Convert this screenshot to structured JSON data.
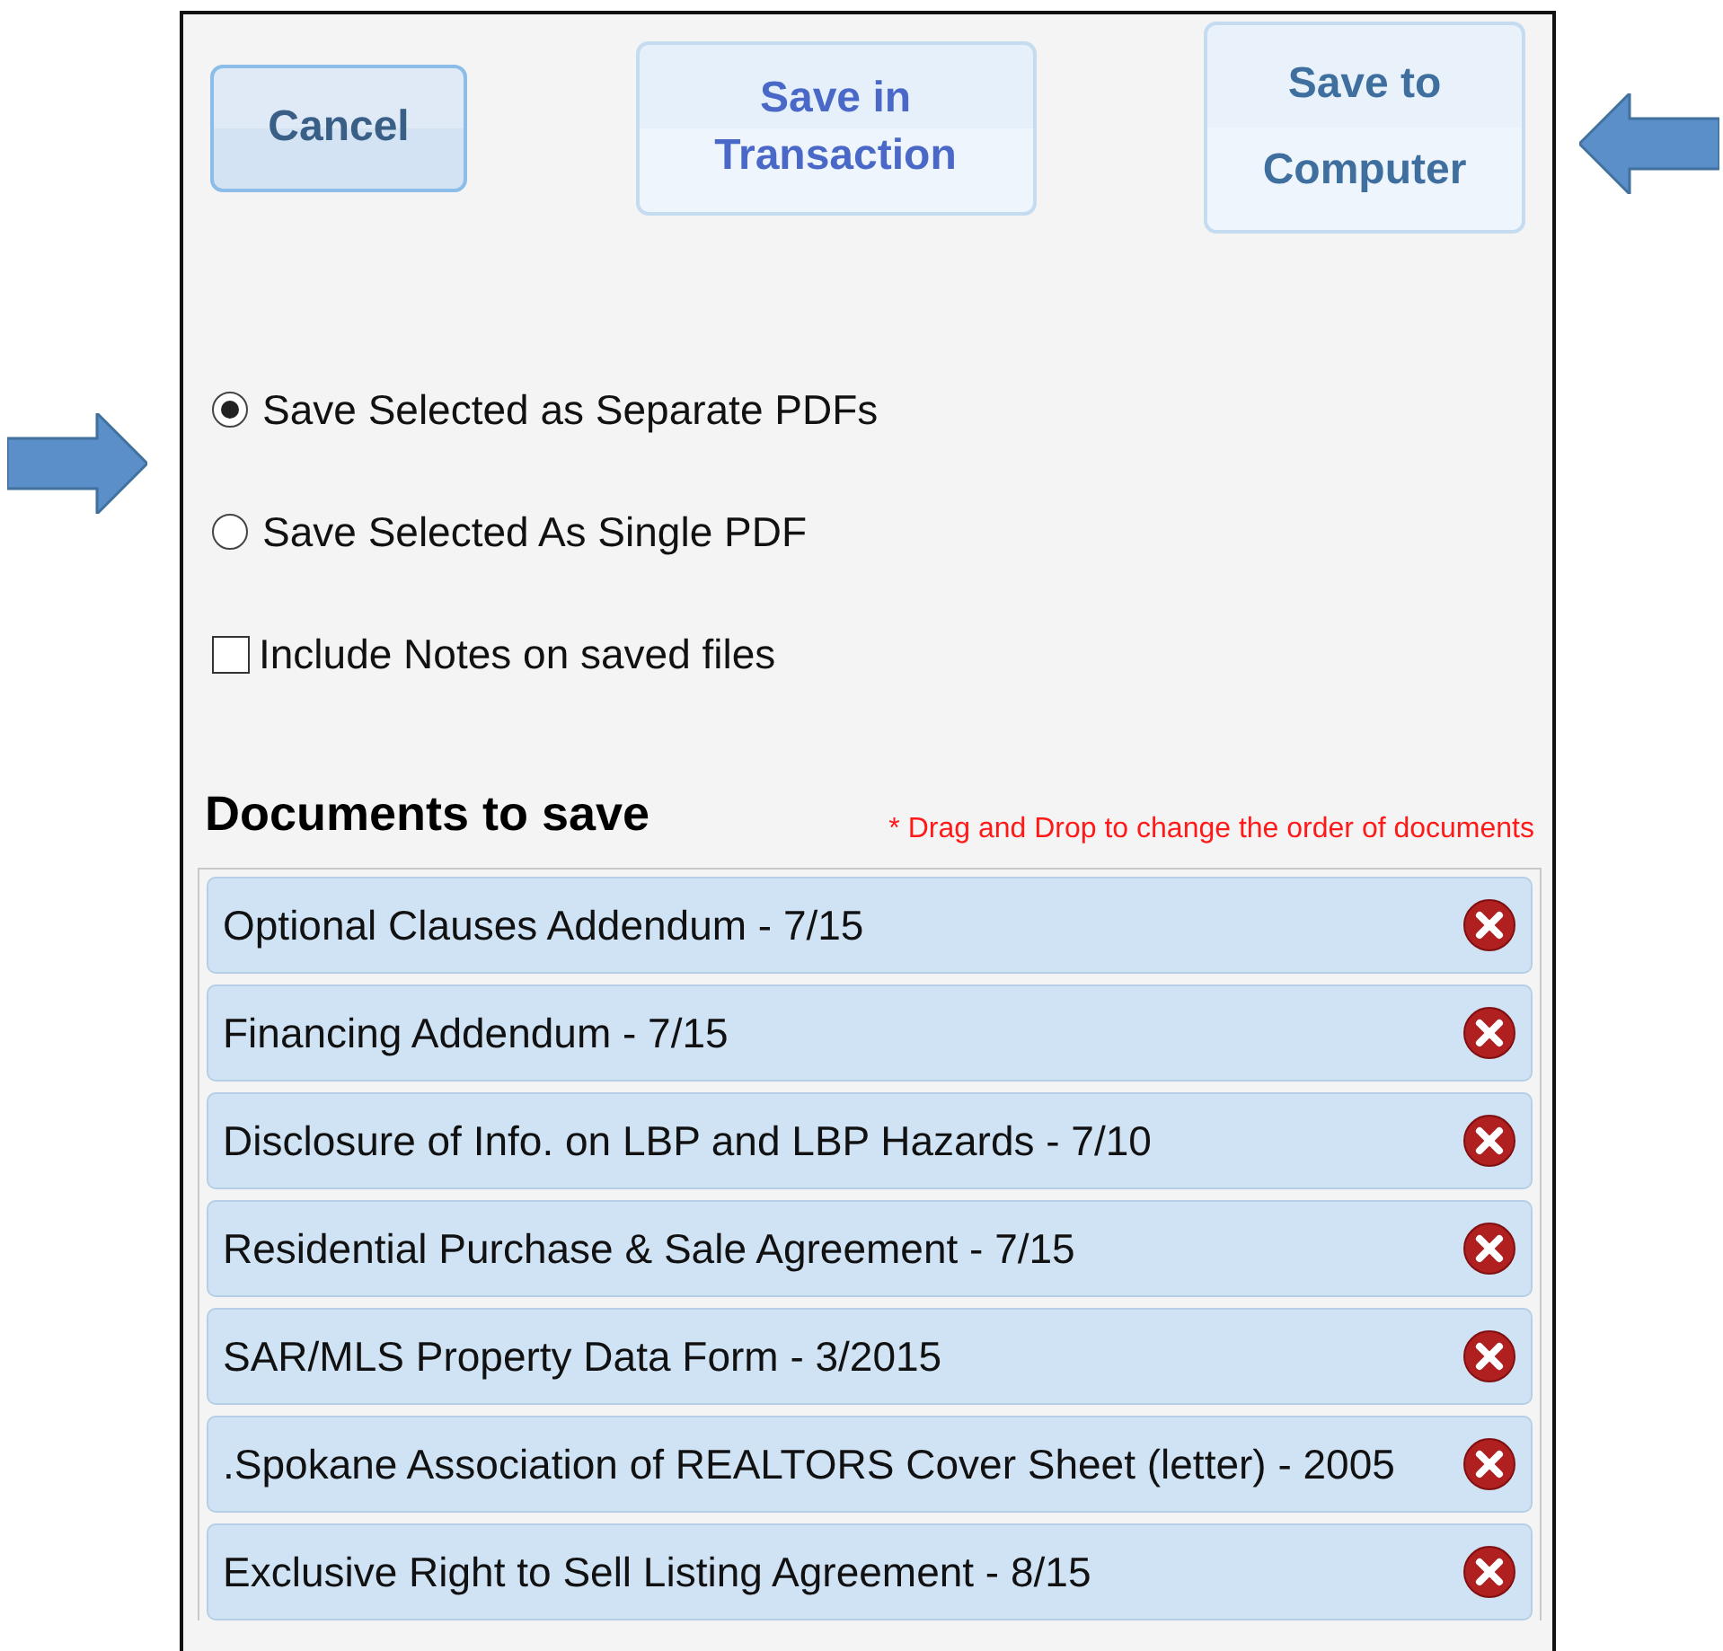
{
  "buttons": [
    {
      "label": "Cancel",
      "kind": "cancel"
    },
    {
      "label": "Save in Transaction",
      "kind": "transaction"
    },
    {
      "label": "Save to Computer",
      "kind": "computer"
    }
  ],
  "options": [
    {
      "kind": "radio",
      "label": "Save Selected as Separate PDFs",
      "selected": true
    },
    {
      "kind": "radio",
      "label": "Save Selected As Single PDF",
      "selected": false
    },
    {
      "kind": "checkbox",
      "label": "Include Notes on saved files",
      "checked": false
    }
  ],
  "documents_heading": "Documents to save",
  "note": "* Drag and Drop to change the order of documents",
  "documents": [
    {
      "name": "Optional Clauses Addendum - 7/15"
    },
    {
      "name": "Financing Addendum - 7/15"
    },
    {
      "name": "Disclosure of Info. on LBP and LBP Hazards - 7/10"
    },
    {
      "name": "Residential Purchase & Sale Agreement - 7/15"
    },
    {
      "name": "SAR/MLS Property Data Form - 3/2015"
    },
    {
      "name": ".Spokane Association of REALTORS Cover Sheet (letter) - 2005"
    },
    {
      "name": "Exclusive Right to Sell Listing Agreement - 8/15"
    }
  ]
}
